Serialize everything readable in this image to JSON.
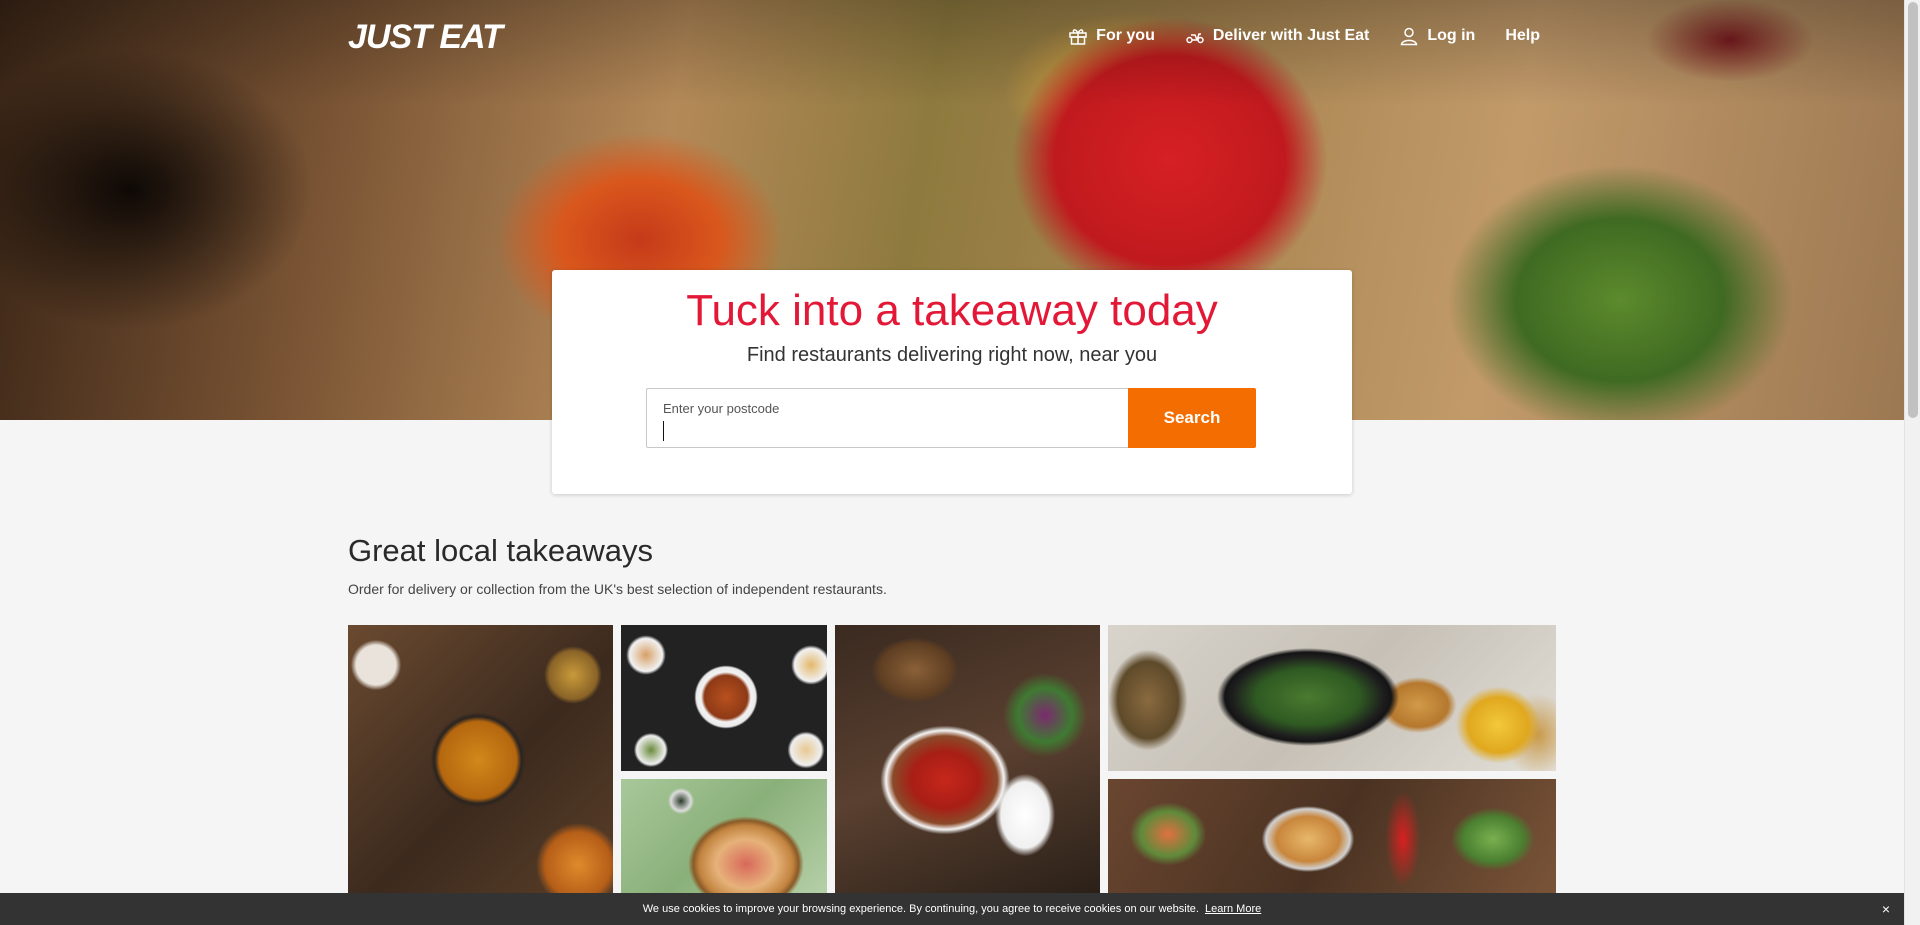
{
  "header": {
    "logo": "JUST EAT",
    "nav": [
      {
        "label": "For you",
        "icon": "gift-icon"
      },
      {
        "label": "Deliver with Just Eat",
        "icon": "scooter-icon"
      },
      {
        "label": "Log in",
        "icon": "user-icon"
      },
      {
        "label": "Help",
        "icon": ""
      }
    ]
  },
  "hero": {
    "title": "Tuck into a takeaway today",
    "subtitle": "Find restaurants delivering right now, near you",
    "postcode_label": "Enter your postcode",
    "postcode_value": "",
    "search_label": "Search"
  },
  "section": {
    "title": "Great local takeaways",
    "subtitle": "Order for delivery or collection from the UK's best selection of independent restaurants."
  },
  "cookie": {
    "text": "We use cookies to improve your browsing experience. By continuing, you agree to receive cookies on our website.",
    "link": "Learn More",
    "close": "×"
  },
  "colors": {
    "brand_red": "#e31837",
    "search_orange": "#f36d00",
    "cookie_bg": "#333333"
  }
}
